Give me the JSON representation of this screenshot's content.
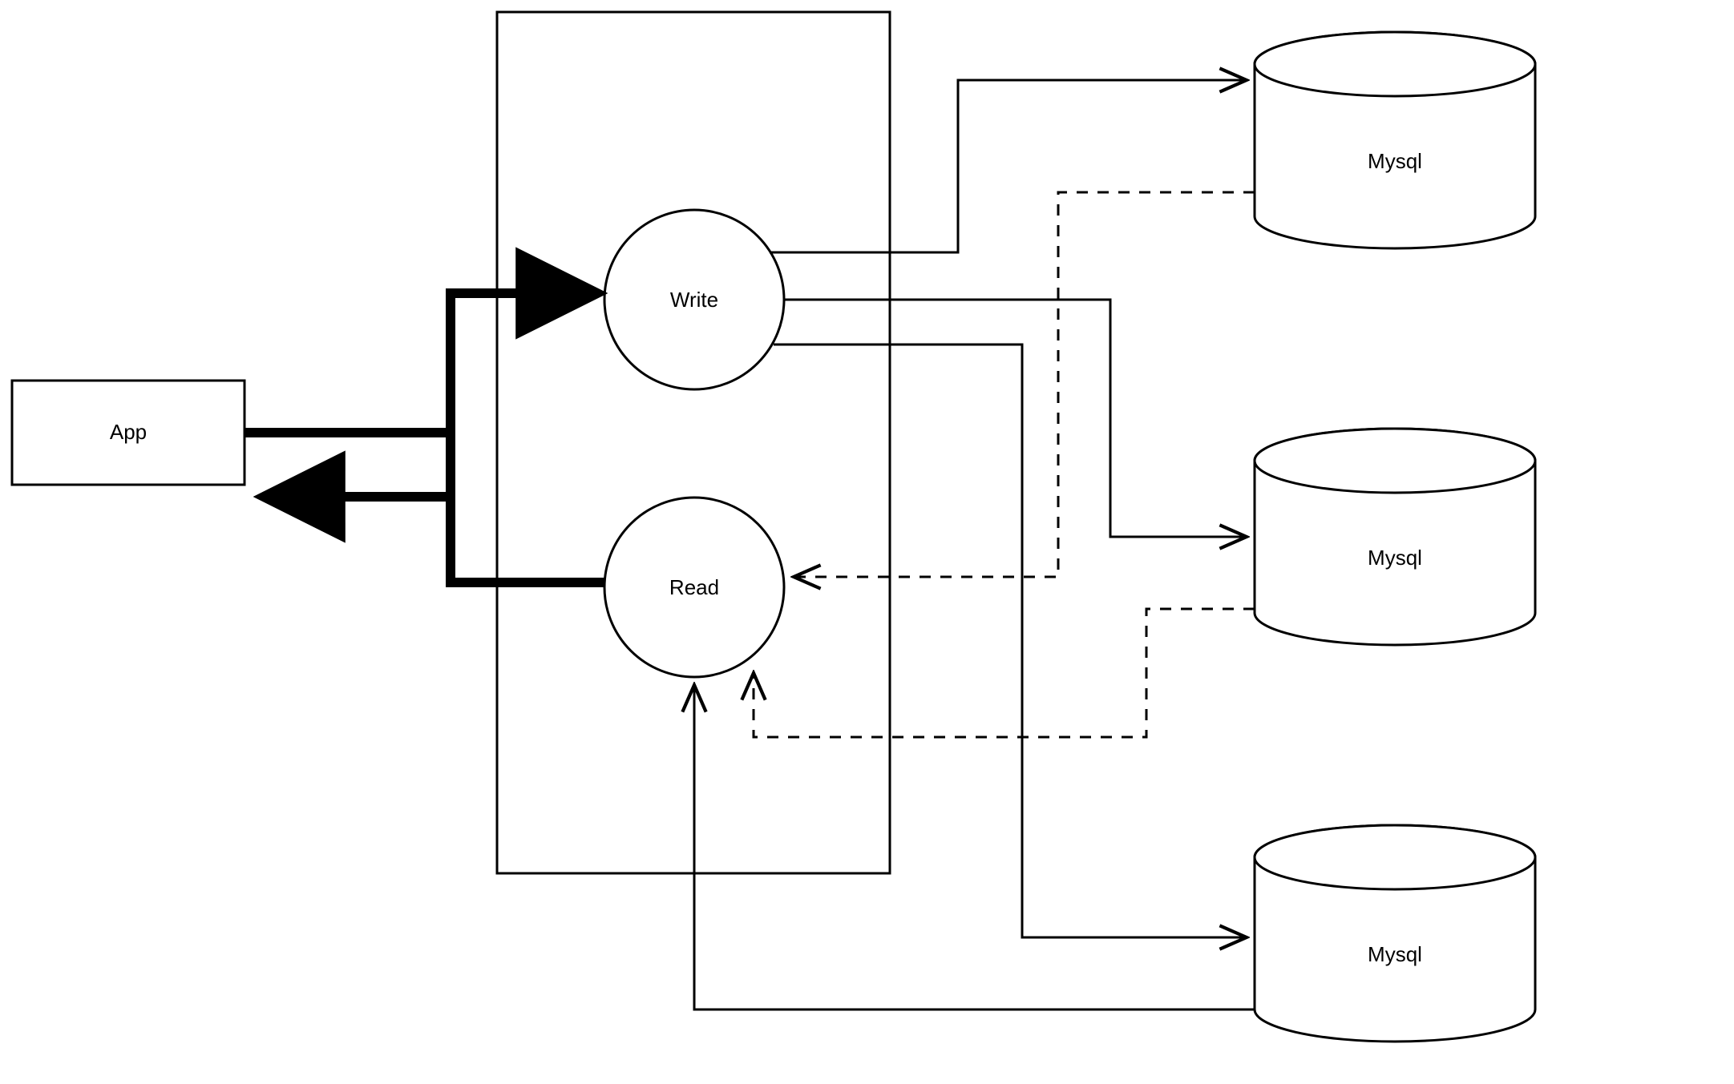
{
  "nodes": {
    "app": {
      "label": "App"
    },
    "write": {
      "label": "Write"
    },
    "read": {
      "label": "Read"
    },
    "db1": {
      "label": "Mysql"
    },
    "db2": {
      "label": "Mysql"
    },
    "db3": {
      "label": "Mysql"
    }
  },
  "edges": [
    {
      "from": "app",
      "to": "write",
      "style": "bold",
      "direction": "forward"
    },
    {
      "from": "read",
      "to": "app",
      "style": "bold",
      "direction": "forward"
    },
    {
      "from": "write",
      "to": "db1",
      "style": "solid",
      "direction": "forward"
    },
    {
      "from": "write",
      "to": "db2",
      "style": "solid",
      "direction": "forward"
    },
    {
      "from": "write",
      "to": "db3",
      "style": "solid",
      "direction": "forward"
    },
    {
      "from": "db1",
      "to": "read",
      "style": "dashed",
      "direction": "forward"
    },
    {
      "from": "db2",
      "to": "read",
      "style": "dashed",
      "direction": "forward"
    },
    {
      "from": "db3",
      "to": "read",
      "style": "solid",
      "direction": "forward"
    }
  ]
}
